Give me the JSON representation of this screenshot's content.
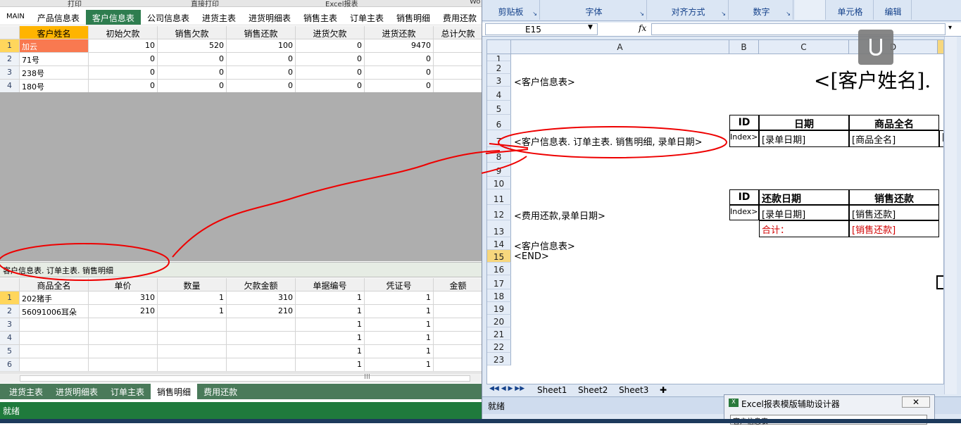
{
  "left_app": {
    "top_strip": [
      "打印",
      "直接打印",
      "Excel报表",
      "Wo"
    ],
    "tabs": [
      "MAIN",
      "产品信息表",
      "客户信息表",
      "公司信息表",
      "进货主表",
      "进货明细表",
      "销售主表",
      "订单主表",
      "销售明细",
      "费用还款"
    ],
    "active_tab": "客户信息表",
    "customer_grid": {
      "headers": [
        "客户姓名",
        "初始欠款",
        "销售欠款",
        "销售还款",
        "进货欠款",
        "进货还款",
        "总计欠款"
      ],
      "rows": [
        {
          "n": "1",
          "cells": [
            "加云",
            "10",
            "520",
            "100",
            "0",
            "9470",
            ""
          ]
        },
        {
          "n": "2",
          "cells": [
            "71号",
            "0",
            "0",
            "0",
            "0",
            "0",
            ""
          ]
        },
        {
          "n": "3",
          "cells": [
            "238号",
            "0",
            "0",
            "0",
            "0",
            "0",
            ""
          ]
        },
        {
          "n": "4",
          "cells": [
            "180号",
            "0",
            "0",
            "0",
            "0",
            "0",
            ""
          ]
        }
      ]
    },
    "subtable_title": "客户信息表. 订单主表. 销售明细",
    "detail_grid": {
      "headers": [
        "商品全名",
        "单价",
        "数量",
        "欠款金额",
        "单据编号",
        "凭证号",
        "金额"
      ],
      "rows": [
        {
          "n": "1",
          "cells": [
            "202猪手",
            "310",
            "1",
            "310",
            "1",
            "1",
            ""
          ]
        },
        {
          "n": "2",
          "cells": [
            "56091006耳朵",
            "210",
            "1",
            "210",
            "1",
            "1",
            ""
          ]
        },
        {
          "n": "3",
          "cells": [
            "",
            "",
            "",
            "",
            "1",
            "1",
            ""
          ]
        },
        {
          "n": "4",
          "cells": [
            "",
            "",
            "",
            "",
            "1",
            "1",
            ""
          ]
        },
        {
          "n": "5",
          "cells": [
            "",
            "",
            "",
            "",
            "1",
            "1",
            ""
          ]
        },
        {
          "n": "6",
          "cells": [
            "",
            "",
            "",
            "",
            "1",
            "1",
            ""
          ]
        }
      ]
    },
    "scroll_mark": "III",
    "sheet_tabs": [
      "进货主表",
      "进货明细表",
      "订单主表",
      "销售明细",
      "费用还款"
    ],
    "active_sheet_tab": "销售明细",
    "status": "就绪"
  },
  "excel": {
    "ribbon_groups": [
      "剪贴板",
      "字体",
      "对齐方式",
      "数字",
      "单元格",
      "编辑"
    ],
    "name_box": "E15",
    "fx": "fx",
    "col_headers": [
      "A",
      "B",
      "C",
      "D"
    ],
    "row_numbers": [
      "1",
      "2",
      "3",
      "4",
      "5",
      "6",
      "7",
      "8",
      "9",
      "10",
      "11",
      "12",
      "13",
      "14",
      "15",
      "16",
      "17",
      "18",
      "19",
      "20",
      "21",
      "22",
      "23"
    ],
    "active_row": "15",
    "cells": {
      "r2a": "<客户信息表>",
      "r2big": "<[客户姓名].",
      "r4": [
        "ID",
        "日期",
        "商品全名"
      ],
      "r5a": "<客户信息表. 订单主表. 销售明细, 录单日期>",
      "r5": [
        "Index>",
        "[录单日期]",
        "[商品全名]",
        "["
      ],
      "r9": [
        "ID",
        "还款日期",
        "销售还款"
      ],
      "r10a": "<费用还款,录单日期>",
      "r10": [
        "Index>",
        "[录单日期]",
        "[销售还款]"
      ],
      "r11": [
        "合计：",
        "[销售还款]"
      ],
      "r12a": "<客户信息表>",
      "r13a": "<END>"
    },
    "sheet_tabs": [
      "Sheet1",
      "Sheet2",
      "Sheet3"
    ],
    "status": "就绪"
  },
  "dialog": {
    "title": "Excel报表模版辅助设计器",
    "close": "✕",
    "field": "客户信息表"
  }
}
